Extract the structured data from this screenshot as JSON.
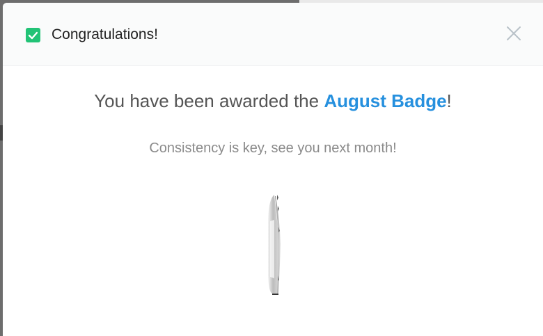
{
  "dialog": {
    "title": "Congratulations!",
    "award_prefix": "You have been awarded the ",
    "badge_name": "August Badge",
    "award_suffix": "!",
    "subtitle": "Consistency is key, see you next month!"
  },
  "colors": {
    "check": "#22c376",
    "badge_link": "#2690de",
    "header_bg": "#fafbfb"
  },
  "icons": {
    "check": "check-icon",
    "close": "close-icon",
    "badge": "badge-coin-icon"
  }
}
